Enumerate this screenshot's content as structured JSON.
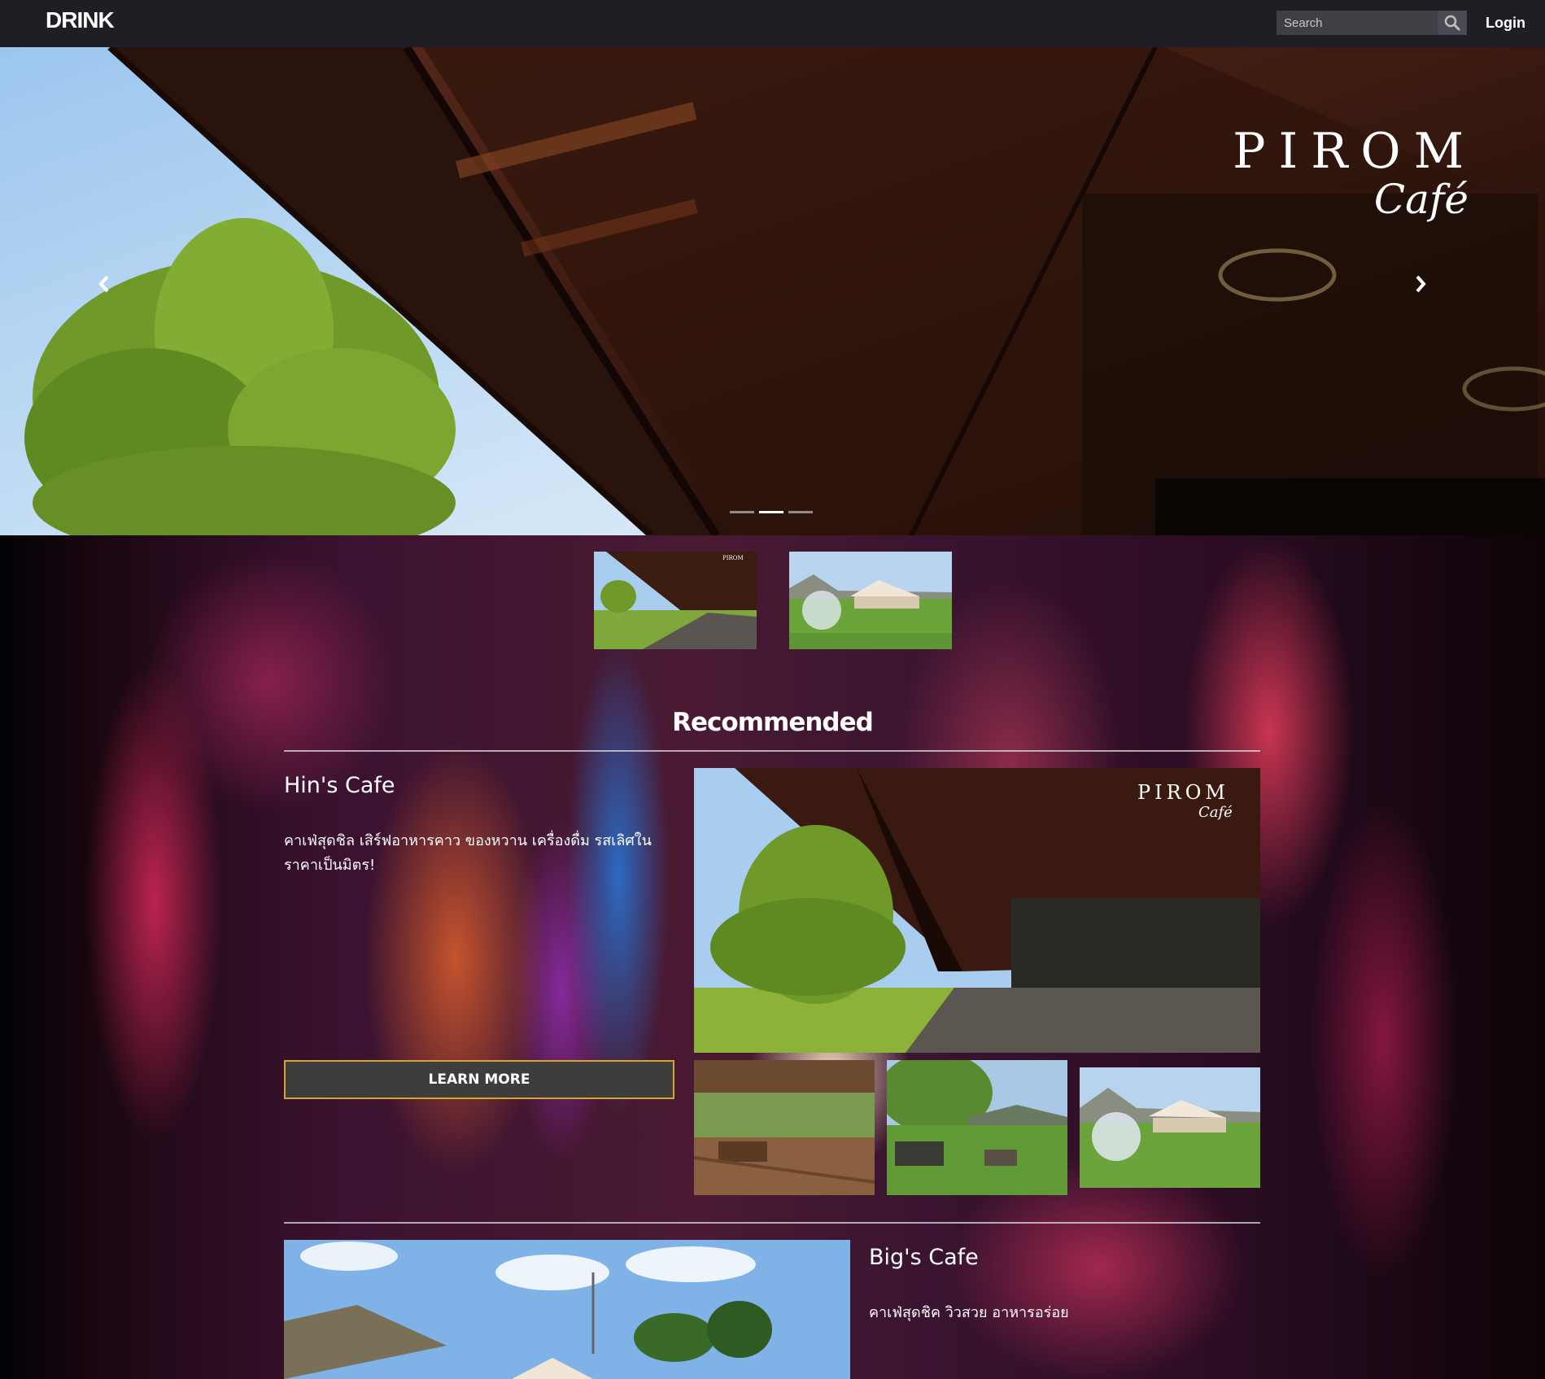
{
  "navbar": {
    "brand": "DRINK",
    "search_placeholder": "Search",
    "search_icon": "magnifier",
    "login_label": "Login"
  },
  "hero": {
    "logo_title": "PIROM",
    "logo_subtitle": "Café",
    "prev_icon": "chevron-left",
    "next_icon": "chevron-right",
    "slide_count": 3,
    "active_slide": 2
  },
  "thumbnails": [
    {
      "name": "thumb-pirom-cafe",
      "logo": "PIROM"
    },
    {
      "name": "thumb-dome-cafe"
    }
  ],
  "recommended": {
    "section_title": "Recommended",
    "cafes": [
      {
        "title": "Hin's Cafe",
        "description": "คาเฟ่สุดชิล เสิร์ฟอาหารคาว ของหวาน เครื่องดื่ม รสเลิศในราคาเป็นมิตร!",
        "button_label": "LEARN MORE",
        "main_photo_logo": "PIROM",
        "main_photo_logo_sub": "Café"
      },
      {
        "title": "Big's Cafe",
        "description": "คาเฟ่สุดชิค วิวสวย อาหารอร่อย"
      }
    ]
  },
  "colors": {
    "navbar_bg": "#1e1e24",
    "button_border": "#d4a72c",
    "button_bg": "#3d3d3d"
  }
}
